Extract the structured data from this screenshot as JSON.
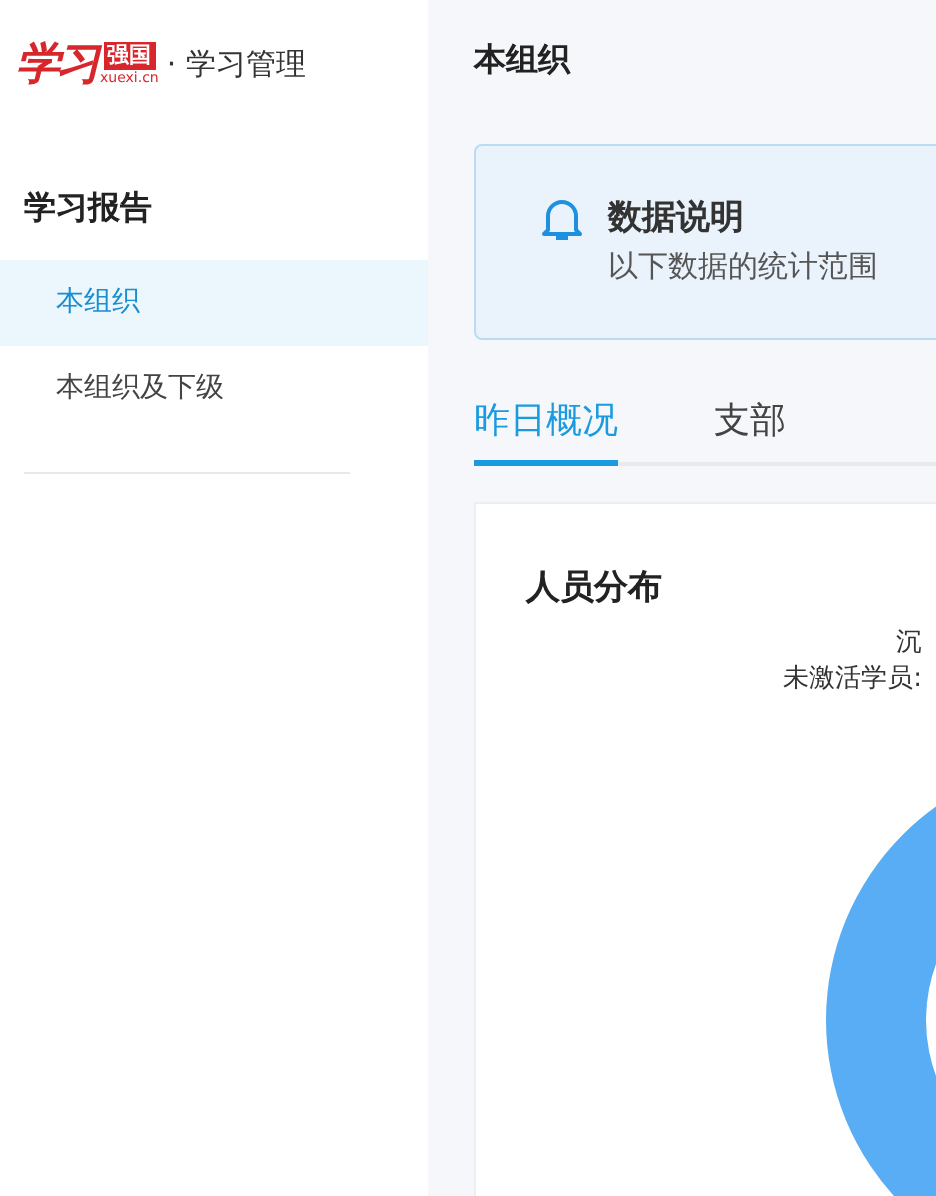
{
  "logo": {
    "script": "学习",
    "badge": "强国",
    "domain": "xuexi.cn",
    "suffix": "· 学习管理"
  },
  "sidebar": {
    "section": "学习报告",
    "items": [
      {
        "label": "本组织",
        "selected": true
      },
      {
        "label": "本组织及下级",
        "selected": false
      }
    ]
  },
  "page_title": "本组织",
  "notice": {
    "title": "数据说明",
    "text": "以下数据的统计范围"
  },
  "tabs": [
    {
      "label": "昨日概况",
      "selected": true
    },
    {
      "label": "支部",
      "selected": false
    }
  ],
  "card": {
    "title": "人员分布",
    "legend": [
      "沉",
      "未激活学员:"
    ]
  }
}
